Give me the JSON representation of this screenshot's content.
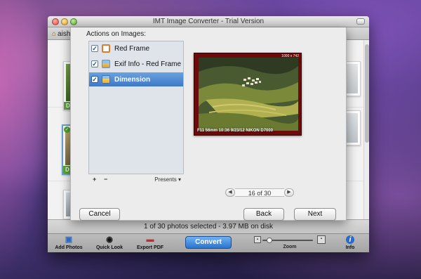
{
  "window": {
    "title": "IMT Image Converter - Trial Version"
  },
  "breadcrumb": {
    "label": "aish"
  },
  "thumbnails": [
    {
      "label": "D",
      "selected": false
    },
    {
      "label": "D",
      "selected": true
    },
    {
      "label": "D",
      "selected": false
    }
  ],
  "sheet": {
    "heading": "Actions on Images:",
    "actions": [
      {
        "label": "Red Frame",
        "checked": true,
        "icon": "frame-icon"
      },
      {
        "label": "Exif Info - Red Frame",
        "checked": true,
        "icon": "exif-image-icon"
      },
      {
        "label": "Dimension",
        "checked": true,
        "icon": "dimension-image-icon",
        "selected": true
      }
    ],
    "add_symbol": "+",
    "remove_symbol": "−",
    "presets_label": "Presents ▾",
    "preview": {
      "size_tag": "1000 x 742",
      "exif_text": "F11 56mm 10:36 9/23/12 NIKON D7000",
      "frame_color": "#6b0b0b"
    },
    "pager": {
      "prev": "◀",
      "next": "▶",
      "label": "16 of 30"
    },
    "cancel_label": "Cancel",
    "back_label": "Back",
    "next_label": "Next"
  },
  "status": {
    "text": "1 of 30 photos selected - 3.97 MB on disk"
  },
  "toolbar": {
    "add_photos": "Add Photos",
    "quick_look": "Quick Look",
    "export_pdf": "Export PDF",
    "convert": "Convert",
    "zoom": "Zoom",
    "info": "Info",
    "zoom_level": 0.1
  },
  "colors": {
    "accent": "#2a73cf",
    "selection": "#3e78c8",
    "label_green": "#5ea33a"
  }
}
